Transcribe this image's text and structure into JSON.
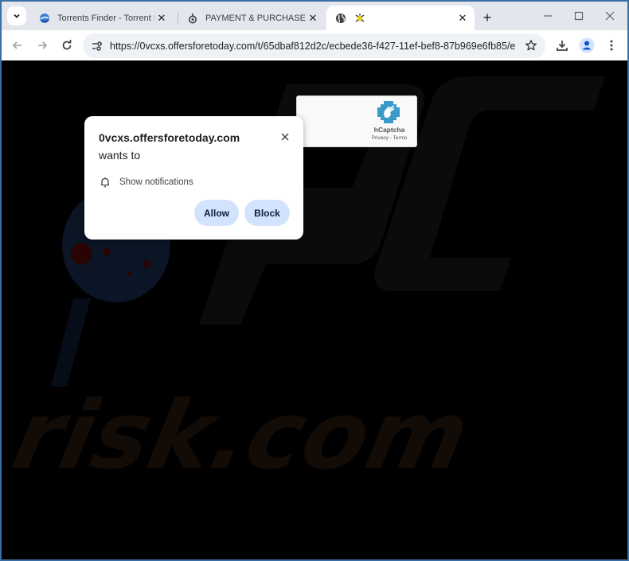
{
  "browser": {
    "tabs": [
      {
        "title": "Torrents Finder - Torrent Fin",
        "favicon": "torrents-finder-favicon",
        "active": false
      },
      {
        "title": "PAYMENT & PURCHASE",
        "favicon": "payment-favicon",
        "active": false
      },
      {
        "title": "",
        "favicon": "globe-icon",
        "active": true
      }
    ],
    "tab_close_glyph": "✕",
    "new_tab_glyph": "+",
    "url": "https://0vcxs.offersforetoday.com/t/65dbaf812d2c/ecbede36-f427-11ef-bef8-87b969e6fb85/e..."
  },
  "captcha": {
    "brand": "hCaptcha",
    "links": "Privacy - Terms"
  },
  "permission_popup": {
    "origin": "0vcxs.offersforetoday.com",
    "wants_to": "wants to",
    "permission": "Show notifications",
    "allow_label": "Allow",
    "block_label": "Block"
  },
  "watermark": {
    "text": "risk.com",
    "logo": "PC"
  },
  "colors": {
    "frame": "#3a6ea5",
    "tabbar": "#e3e7ed",
    "button_bg": "#d3e3fd",
    "page_bg": "#000000"
  }
}
